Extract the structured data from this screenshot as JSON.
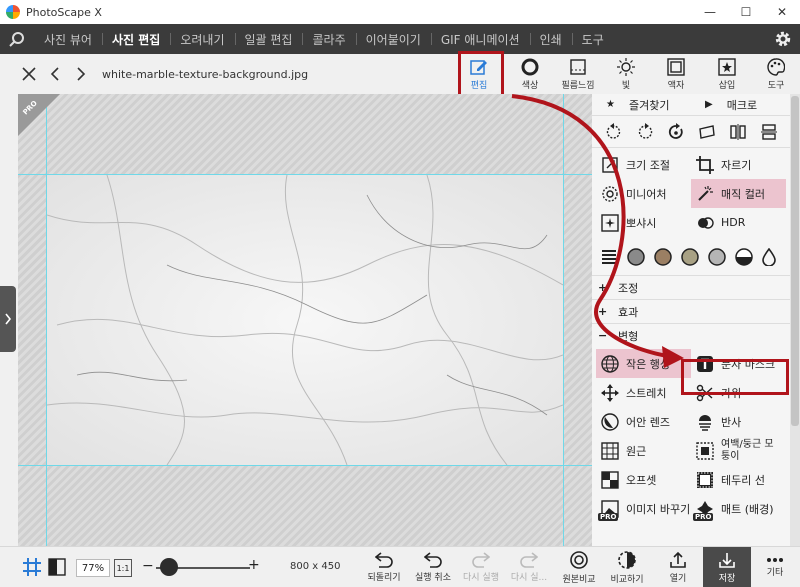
{
  "app": {
    "title": "PhotoScape X"
  },
  "window": {
    "min": "—",
    "max": "☐",
    "close": "✕"
  },
  "nav": {
    "tabs": [
      "사진 뷰어",
      "사진 편집",
      "오려내기",
      "일괄 편집",
      "콜라주",
      "이어붙이기",
      "GIF 애니메이션",
      "인쇄",
      "도구"
    ],
    "active_index": 1
  },
  "toolbar": {
    "filename": "white-marble-texture-background.jpg",
    "tools": [
      {
        "label": "편집",
        "icon": "edit-icon",
        "active": true
      },
      {
        "label": "색상",
        "icon": "color-icon"
      },
      {
        "label": "필름느낌",
        "icon": "film-icon"
      },
      {
        "label": "빛",
        "icon": "light-icon"
      },
      {
        "label": "액자",
        "icon": "frame-icon"
      },
      {
        "label": "삽입",
        "icon": "insert-icon"
      },
      {
        "label": "도구",
        "icon": "palette-icon"
      }
    ]
  },
  "canvas": {
    "badge": "PRO"
  },
  "panel": {
    "favorites": "즐겨찾기",
    "macro": "매크로",
    "tools": [
      {
        "label": "크기 조절",
        "icon": "resize-icon"
      },
      {
        "label": "자르기",
        "icon": "crop-icon"
      },
      {
        "label": "미니어처",
        "icon": "miniature-icon"
      },
      {
        "label": "매직 컬러",
        "icon": "magic-wand-icon"
      },
      {
        "label": "뽀샤시",
        "icon": "sparkle-icon"
      },
      {
        "label": "HDR",
        "icon": "hdr-icon"
      }
    ],
    "sections": [
      {
        "label": "조정",
        "glyph": "+"
      },
      {
        "label": "효과",
        "glyph": "+"
      },
      {
        "label": "변형",
        "glyph": "−"
      }
    ],
    "transform_tools": [
      {
        "label": "작은 행성",
        "icon": "globe-icon"
      },
      {
        "label": "문자 마스크",
        "icon": "text-mask-icon"
      },
      {
        "label": "스트레치",
        "icon": "stretch-icon"
      },
      {
        "label": "가위",
        "icon": "scissors-icon"
      },
      {
        "label": "어안 렌즈",
        "icon": "fisheye-icon"
      },
      {
        "label": "반사",
        "icon": "reflect-icon"
      },
      {
        "label": "원근",
        "icon": "perspective-icon"
      },
      {
        "label": "여백/둥근 모\n퉁이",
        "icon": "margin-icon"
      },
      {
        "label": "오프셋",
        "icon": "offset-icon"
      },
      {
        "label": "테두리 선",
        "icon": "border-icon"
      },
      {
        "label": "이미지 바꾸기",
        "icon": "swap-image-icon"
      },
      {
        "label": "매트 (배경)",
        "icon": "matte-icon"
      }
    ]
  },
  "bottom": {
    "zoom": "77%",
    "one_to_one": "1:1",
    "minus": "−",
    "plus": "+",
    "dimensions": "800 x 450",
    "zoom_level": 0.14,
    "buttons": {
      "revert": "되돌리기",
      "undo": "실행 취소",
      "redo": "다시 실행",
      "redo_all": "다시 실...",
      "original": "원본비교",
      "compare": "비교하기",
      "open": "열기",
      "save": "저장",
      "more": "기타"
    }
  },
  "pro_label": "PRO",
  "colors": {
    "accent": "#2a7bd6",
    "annotation_red": "#b0141b",
    "nav_bg": "#3b3b3b",
    "highlight_pink": "#ecc4cf"
  }
}
